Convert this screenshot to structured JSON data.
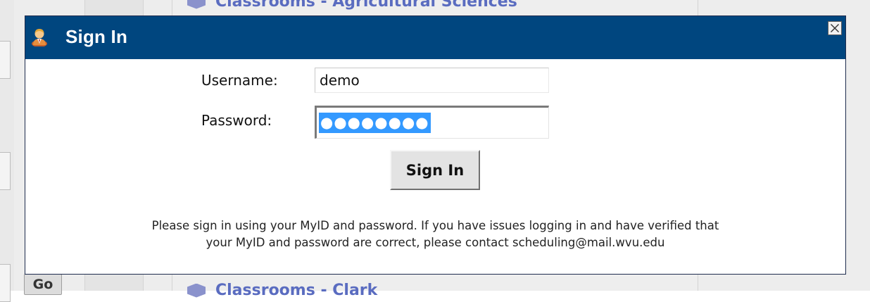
{
  "background": {
    "heading_top": "Classrooms - Agricultural Sciences",
    "heading_bottom": "Classrooms - Clark",
    "go_button_label": "Go"
  },
  "dialog": {
    "title": "Sign In",
    "title_icon": "user-icon",
    "close_icon": "close-icon",
    "titlebar_color": "#00467f"
  },
  "form": {
    "username_label": "Username:",
    "username_value": "demo",
    "password_label": "Password:",
    "password_masked": "●●●●●●●●",
    "submit_label": "Sign In"
  },
  "notice": {
    "line1": "Please sign in using your MyID and password. If you have issues logging in and have verified that",
    "line2": "your MyID and password are correct, please contact scheduling@mail.wvu.edu"
  }
}
